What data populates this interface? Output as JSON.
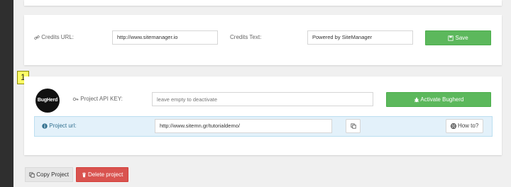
{
  "credits": {
    "url_label": "Credits URL:",
    "url_value": "http://www.sitemanager.io",
    "text_label": "Credits Text:",
    "text_value": "Powered by SiteManager",
    "save_label": "Save"
  },
  "bugherd": {
    "step_badge": "1",
    "logo_text": "BugHerd",
    "api_key_label": "Project API KEY:",
    "api_key_value": "",
    "api_key_placeholder": "leave empty to deactivate",
    "activate_label": "Activate Bugherd",
    "project_url_label": "Project url:",
    "project_url_value": "http://www.sitemn.gr/tutorialdemo/",
    "how_to_label": "How to?"
  },
  "actions": {
    "copy_label": "Copy Project",
    "delete_label": "Delete project"
  },
  "colors": {
    "success": "#5cb85c",
    "danger": "#d9534f",
    "info_bg": "#e3f1fa",
    "info_text": "#31708f",
    "badge": "#ffff66"
  }
}
